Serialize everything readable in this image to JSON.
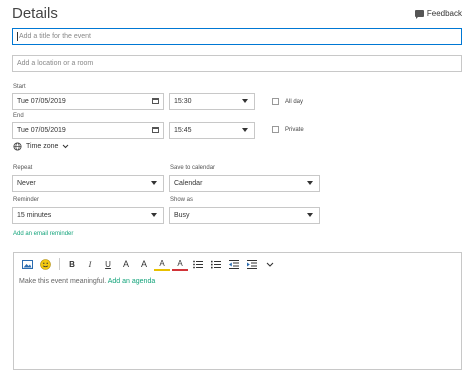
{
  "header": {
    "title": "Details",
    "feedback_label": "Feedback"
  },
  "title_input": {
    "placeholder": "Add a title for the event"
  },
  "location_input": {
    "placeholder": "Add a location or a room"
  },
  "start": {
    "label": "Start",
    "date": "Tue 07/05/2019",
    "time": "15:30"
  },
  "end": {
    "label": "End",
    "date": "Tue 07/05/2019",
    "time": "15:45"
  },
  "all_day_label": "All day",
  "private_label": "Private",
  "time_zone_label": "Time zone",
  "repeat": {
    "label": "Repeat",
    "value": "Never"
  },
  "save_to_calendar": {
    "label": "Save to calendar",
    "value": "Calendar"
  },
  "reminder": {
    "label": "Reminder",
    "value": "15 minutes"
  },
  "show_as": {
    "label": "Show as",
    "value": "Busy"
  },
  "email_reminder_link": "Add an email reminder",
  "editor": {
    "body_text": "Make this event meaningful.",
    "agenda_link": "Add an agenda",
    "toolbar": {
      "bold": "B",
      "italic": "I",
      "underline": "U",
      "font_size": "A",
      "grow": "A",
      "highlight": "A",
      "font_color": "A"
    }
  },
  "colors": {
    "accent": "#0078d4",
    "link": "#12a37a",
    "highlight": "#e8c000",
    "font_color": "#d13438"
  }
}
